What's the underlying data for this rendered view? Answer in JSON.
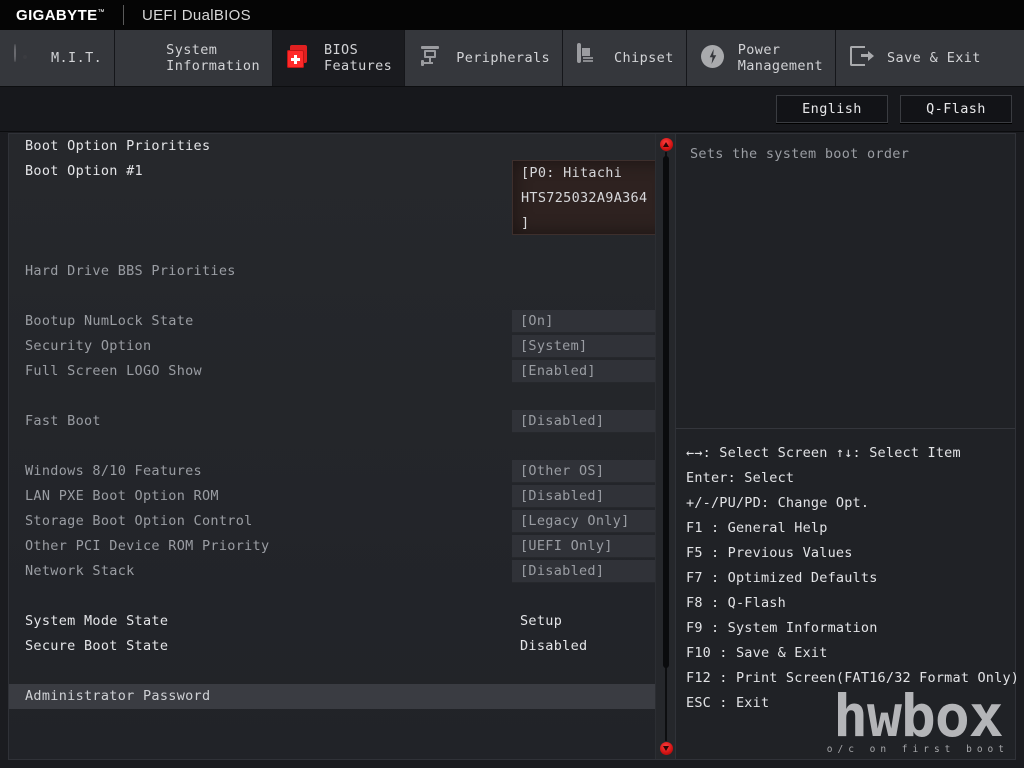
{
  "brand": {
    "logo": "GIGABYTE",
    "logo_tm": "™",
    "subtitle": "UEFI DualBIOS"
  },
  "tabs": [
    {
      "id": "mit",
      "label": "M.I.T.",
      "icon": "disc-icon",
      "active": false
    },
    {
      "id": "system-info",
      "label": "System\nInformation",
      "icon": "gear-icon",
      "active": false
    },
    {
      "id": "bios-features",
      "label": "BIOS\nFeatures",
      "icon": "bios-chip-icon",
      "active": true
    },
    {
      "id": "peripherals",
      "label": "Peripherals",
      "icon": "peripherals-icon",
      "active": false
    },
    {
      "id": "chipset",
      "label": "Chipset",
      "icon": "chipset-icon",
      "active": false
    },
    {
      "id": "power",
      "label": "Power\nManagement",
      "icon": "power-bolt-icon",
      "active": false
    },
    {
      "id": "save-exit",
      "label": "Save & Exit",
      "icon": "exit-door-icon",
      "active": false
    }
  ],
  "actionbar": {
    "language": "English",
    "qflash": "Q-Flash"
  },
  "settings": {
    "rows": [
      {
        "label": "Boot Option Priorities",
        "value": "",
        "style": "bright",
        "kind": "header"
      },
      {
        "label": "Boot Option #1",
        "value": "",
        "style": "bright",
        "kind": "dropdown"
      },
      {
        "label": "",
        "value": "",
        "style": "dim",
        "kind": "spacer"
      },
      {
        "label": "",
        "value": "",
        "style": "dim",
        "kind": "spacer"
      },
      {
        "label": "",
        "value": "",
        "style": "dim",
        "kind": "spacer"
      },
      {
        "label": "Hard Drive BBS Priorities",
        "value": "",
        "style": "dim",
        "kind": "link"
      },
      {
        "label": "",
        "value": "",
        "style": "dim",
        "kind": "spacer"
      },
      {
        "label": "Bootup NumLock State",
        "value": "[On]",
        "style": "dim",
        "kind": "option"
      },
      {
        "label": "Security Option",
        "value": "[System]",
        "style": "dim",
        "kind": "option"
      },
      {
        "label": "Full Screen LOGO Show",
        "value": "[Enabled]",
        "style": "dim",
        "kind": "option"
      },
      {
        "label": "",
        "value": "",
        "style": "dim",
        "kind": "spacer"
      },
      {
        "label": "Fast Boot",
        "value": "[Disabled]",
        "style": "dim",
        "kind": "option"
      },
      {
        "label": "",
        "value": "",
        "style": "dim",
        "kind": "spacer"
      },
      {
        "label": "Windows 8/10 Features",
        "value": "[Other OS]",
        "style": "dim",
        "kind": "option"
      },
      {
        "label": "LAN PXE Boot Option ROM",
        "value": "[Disabled]",
        "style": "dim",
        "kind": "option"
      },
      {
        "label": "Storage Boot Option Control",
        "value": "[Legacy Only]",
        "style": "dim",
        "kind": "option"
      },
      {
        "label": "Other PCI Device ROM Priority",
        "value": "[UEFI Only]",
        "style": "dim",
        "kind": "option"
      },
      {
        "label": "Network Stack",
        "value": "[Disabled]",
        "style": "dim",
        "kind": "option"
      },
      {
        "label": "",
        "value": "",
        "style": "dim",
        "kind": "spacer"
      },
      {
        "label": "System Mode State",
        "value": "Setup",
        "style": "bright",
        "kind": "readonly"
      },
      {
        "label": "Secure Boot State",
        "value": "Disabled",
        "style": "bright",
        "kind": "readonly"
      },
      {
        "label": "",
        "value": "",
        "style": "dim",
        "kind": "spacer"
      },
      {
        "label": "Administrator Password",
        "value": "",
        "style": "selected",
        "kind": "password"
      }
    ],
    "boot_option_value": [
      "[P0: Hitachi",
      "HTS725032A9A364",
      "]"
    ]
  },
  "help": {
    "description": "Sets the system boot order",
    "keys": [
      "←→: Select Screen    ↑↓: Select Item",
      "Enter: Select",
      "+/-/PU/PD: Change Opt.",
      "F1  : General Help",
      "F5  : Previous Values",
      "F7  : Optimized Defaults",
      "F8  : Q-Flash",
      "F9  : System Information",
      "F10 : Save & Exit",
      "F12 : Print Screen(FAT16/32 Format Only)",
      "ESC : Exit"
    ]
  },
  "watermark": {
    "main": "hwbox",
    "tagline": "o/c on first boot"
  },
  "colors": {
    "accent_red": "#ff2a2a",
    "panel_bg": "#232529",
    "value_bg": "#303238",
    "selected_band": "#3a3c42",
    "dropdown_bg": "#2e2220"
  }
}
